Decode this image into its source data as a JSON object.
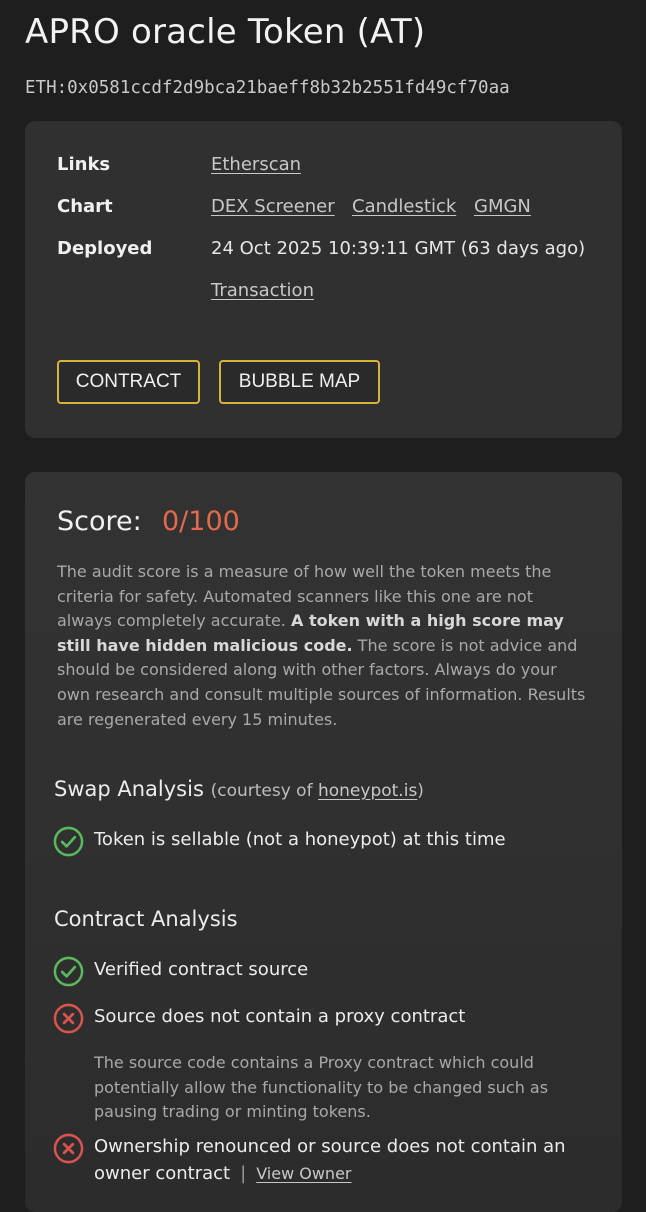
{
  "token": {
    "title": "APRO oracle Token (AT)",
    "address": "ETH:0x0581ccdf2d9bca21baeff8b32b2551fd49cf70aa"
  },
  "info": {
    "links_label": "Links",
    "links": [
      "Etherscan"
    ],
    "chart_label": "Chart",
    "charts": [
      "DEX Screener",
      "Candlestick",
      "GMGN"
    ],
    "deployed_label": "Deployed",
    "deployed_value": "24 Oct 2025 10:39:11 GMT (63 days ago)",
    "transaction_link": "Transaction",
    "contract_button": "CONTRACT",
    "bubble_map_button": "BUBBLE MAP"
  },
  "score": {
    "label": "Score:",
    "value": "0/100",
    "value_color": "#e2694b",
    "desc_part1": "The audit score is a measure of how well the token meets the criteria for safety. Automated scanners like this one are not always completely accurate. ",
    "desc_bold": "A token with a high score may still have hidden malicious code.",
    "desc_part2": " The score is not advice and should be considered along with other factors. Always do your own research and consult multiple sources of information. Results are regenerated every 15 minutes."
  },
  "swap": {
    "title": "Swap Analysis",
    "courtesy_prefix": "(courtesy of ",
    "courtesy_link": "honeypot.is",
    "courtesy_suffix": ")",
    "items": [
      {
        "text": "Token is sellable (not a honeypot) at this time",
        "status": "pass",
        "icon": "check-circle-icon"
      }
    ]
  },
  "contract": {
    "title": "Contract Analysis",
    "items": [
      {
        "text": "Verified contract source",
        "status": "pass",
        "icon": "check-circle-icon"
      },
      {
        "text": "Source does not contain a proxy contract",
        "status": "fail",
        "icon": "x-circle-icon",
        "note": "The source code contains a Proxy contract which could potentially allow the functionality to be changed such as pausing trading or minting tokens."
      },
      {
        "text": "Ownership renounced or source does not contain an owner contract",
        "status": "fail",
        "icon": "x-circle-icon",
        "separator": "|",
        "link": "View Owner"
      }
    ]
  },
  "colors": {
    "pass": "#5cb85c",
    "fail": "#d9534f",
    "button_border": "#d6b43a"
  }
}
